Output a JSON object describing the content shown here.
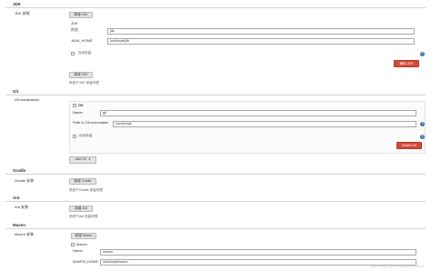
{
  "jdk": {
    "title": "JDK",
    "installations_label": "JDK 安装",
    "add_button": "新增 JDK",
    "item_label": "JDK",
    "alias_label": "别名",
    "alias_value": "jdk",
    "home_label": "JAVA_HOME",
    "home_value": "/usr/local/jdk",
    "auto_install_label": "自动安装",
    "delete_button": "删除 JDK",
    "add_button_bottom": "新增 JDK",
    "list_note": "系统下JDK 安装列表"
  },
  "git": {
    "title": "Git",
    "installations_label": "Git installations",
    "item_label": "Git",
    "name_label": "Name",
    "name_value": "git",
    "path_label": "Path to Git executable",
    "path_value": "/usr/bin/git",
    "auto_install_label": "自动安装",
    "delete_button": "Delete Git",
    "add_button": "Add Git",
    "add_arrow": "▾"
  },
  "gradle": {
    "title": "Gradle",
    "installations_label": "Gradle 安装",
    "add_button": "新增 Gradle",
    "list_note": "系统下Gradle 安装列表"
  },
  "ant": {
    "title": "Ant",
    "installations_label": "Ant 安装",
    "add_button": "新增 Ant",
    "list_note": "系统下Ant 安装列表"
  },
  "maven": {
    "title": "Maven",
    "installations_label": "Maven 安装",
    "add_button": "新增 Maven",
    "item_label": "Maven",
    "name_label": "Name",
    "name_value": "maven",
    "home_label": "MAVEN_HOME",
    "home_value": "/usr/local/maven"
  },
  "help_glyph": "?",
  "watermark": "http://blog.csdn.net/jenkinsmaven",
  "colors": {
    "delete_button": "#d24939",
    "help_icon": "#3f70b5",
    "button_bg": "#e4e4e4",
    "divider": "#d3d3d3"
  }
}
